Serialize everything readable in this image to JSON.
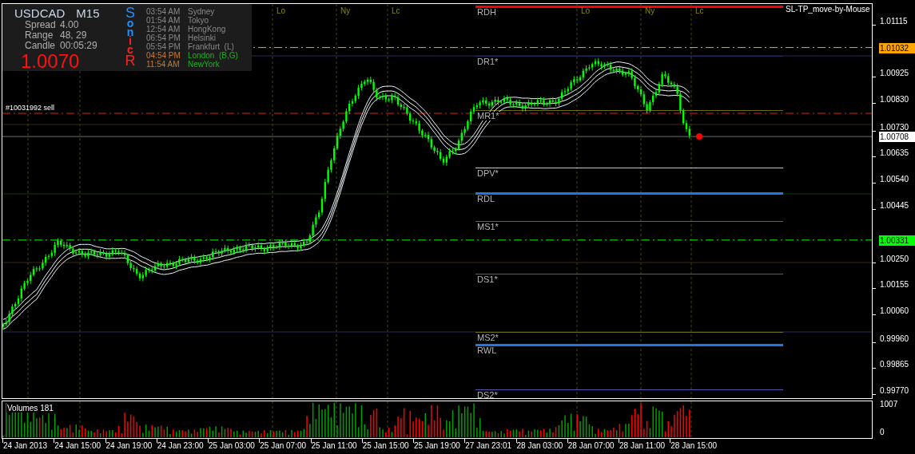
{
  "info_panel": {
    "symbol": "USDCAD",
    "timeframe": "M15",
    "stats": [
      {
        "label": "Spread",
        "value": "4.00"
      },
      {
        "label": "Range",
        "value": "48, 29"
      },
      {
        "label": "Candle",
        "value": "00:05:29"
      }
    ],
    "price": "1.0070",
    "brand_letters": [
      {
        "text": "S",
        "color": "#1e90ff"
      },
      {
        "text": "o",
        "color": "#1e90ff"
      },
      {
        "text": "n",
        "color": "#1e90ff"
      },
      {
        "text": "i",
        "color": "#ff2020"
      },
      {
        "text": "c",
        "color": "#ff2020"
      },
      {
        "text": "R",
        "color": "#ff2020"
      }
    ],
    "sessions": [
      {
        "time": "03:54 AM",
        "city": "Sydney",
        "active": false
      },
      {
        "time": "01:54 AM",
        "city": "Tokyo",
        "active": false
      },
      {
        "time": "12:54 AM",
        "city": "HongKong",
        "active": false
      },
      {
        "time": "06:54 PM",
        "city": "Helsinki",
        "active": false
      },
      {
        "time": "05:54 PM",
        "city": "Frankfurt  (L)",
        "active": false
      },
      {
        "time": "04:54 PM",
        "city": "London  (B,G)",
        "active": true
      },
      {
        "time": "11:54 AM",
        "city": "NewYork",
        "active": true
      }
    ]
  },
  "session_markers": [
    "Lo",
    "Ny",
    "Lc",
    "Lo",
    "Ny",
    "Lc"
  ],
  "expert_label": "SL-TP_move-by-Mouse",
  "order_line": {
    "label": "#10031992 sell"
  },
  "pivot_levels": [
    {
      "label": "RDH",
      "color": "#ff0000",
      "kind": "range"
    },
    {
      "label": "DR1*",
      "color": "#28285a",
      "kind": "pivot"
    },
    {
      "label": "MR1*",
      "color": "#6b6b10",
      "kind": "pivot"
    },
    {
      "label": "DPV*",
      "color": "#c8c8c8",
      "kind": "pivot"
    },
    {
      "label": "RDL",
      "color": "#1e78e0",
      "kind": "range"
    },
    {
      "label": "MS1*",
      "color": "#6b6b10",
      "kind": "pivot"
    },
    {
      "label": "DS1*",
      "color": "#5a50b0",
      "kind": "pivot"
    },
    {
      "label": "MS2*",
      "color": "#6b6b10",
      "kind": "pivot"
    },
    {
      "label": "RWL",
      "color": "#1e78e0",
      "kind": "range"
    },
    {
      "label": "DS2*",
      "color": "#5a50b0",
      "kind": "pivot"
    }
  ],
  "price_axis": {
    "ticks": [
      "1.01115",
      "1.00925",
      "1.00830",
      "1.00730",
      "1.00635",
      "1.00540",
      "1.00445",
      "1.00250",
      "1.00155",
      "1.00060",
      "0.99960",
      "0.99865",
      "0.99770"
    ],
    "markers": [
      {
        "value": "1.01032",
        "color": "#ffa500",
        "kind": "alert"
      },
      {
        "value": "1.00708",
        "color": "#ffffff",
        "kind": "bid"
      },
      {
        "value": "1.00331",
        "color": "#00ff00",
        "kind": "alert"
      }
    ]
  },
  "volume_pane": {
    "label": "Volumes 181",
    "max": "1007",
    "min": "0"
  },
  "time_axis": [
    "24 Jan 2013",
    "24 Jan 15:00",
    "24 Jan 19:00",
    "24 Jan 23:00",
    "25 Jan 03:00",
    "25 Jan 07:00",
    "25 Jan 11:00",
    "25 Jan 15:00",
    "25 Jan 19:00",
    "27 Jan 23:01",
    "28 Jan 03:00",
    "28 Jan 07:00",
    "28 Jan 11:00",
    "28 Jan 15:00"
  ]
}
